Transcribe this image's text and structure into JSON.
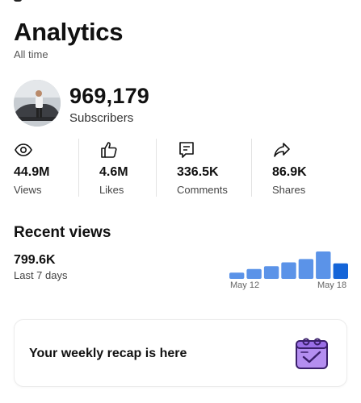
{
  "header": {
    "title": "Analytics",
    "period": "All time"
  },
  "channel": {
    "subscribers": "969,179",
    "subscribers_label": "Subscribers"
  },
  "stats": [
    {
      "icon": "eye-icon",
      "value": "44.9M",
      "label": "Views"
    },
    {
      "icon": "thumbs-up-icon",
      "value": "4.6M",
      "label": "Likes"
    },
    {
      "icon": "comment-icon",
      "value": "336.5K",
      "label": "Comments"
    },
    {
      "icon": "share-icon",
      "value": "86.9K",
      "label": "Shares"
    }
  ],
  "recent_views": {
    "title": "Recent views",
    "value": "799.6K",
    "period_label": "Last 7 days",
    "tick_start": "May 12",
    "tick_end": "May 18"
  },
  "chart_data": {
    "type": "bar",
    "categories": [
      "May 12",
      "May 13",
      "May 14",
      "May 15",
      "May 16",
      "May 17",
      "May 18"
    ],
    "values": [
      28,
      44,
      57,
      74,
      89,
      123,
      70
    ],
    "highlight_index": 6,
    "bar_color": "#5b93e8",
    "highlight_color": "#1565d8",
    "xlabel": "",
    "ylabel": ""
  },
  "recap": {
    "text": "Your weekly recap is here",
    "icon": "calendar-check-icon"
  },
  "colors": {
    "accent": "#1565d8",
    "recap_icon": "#b48ef0"
  }
}
